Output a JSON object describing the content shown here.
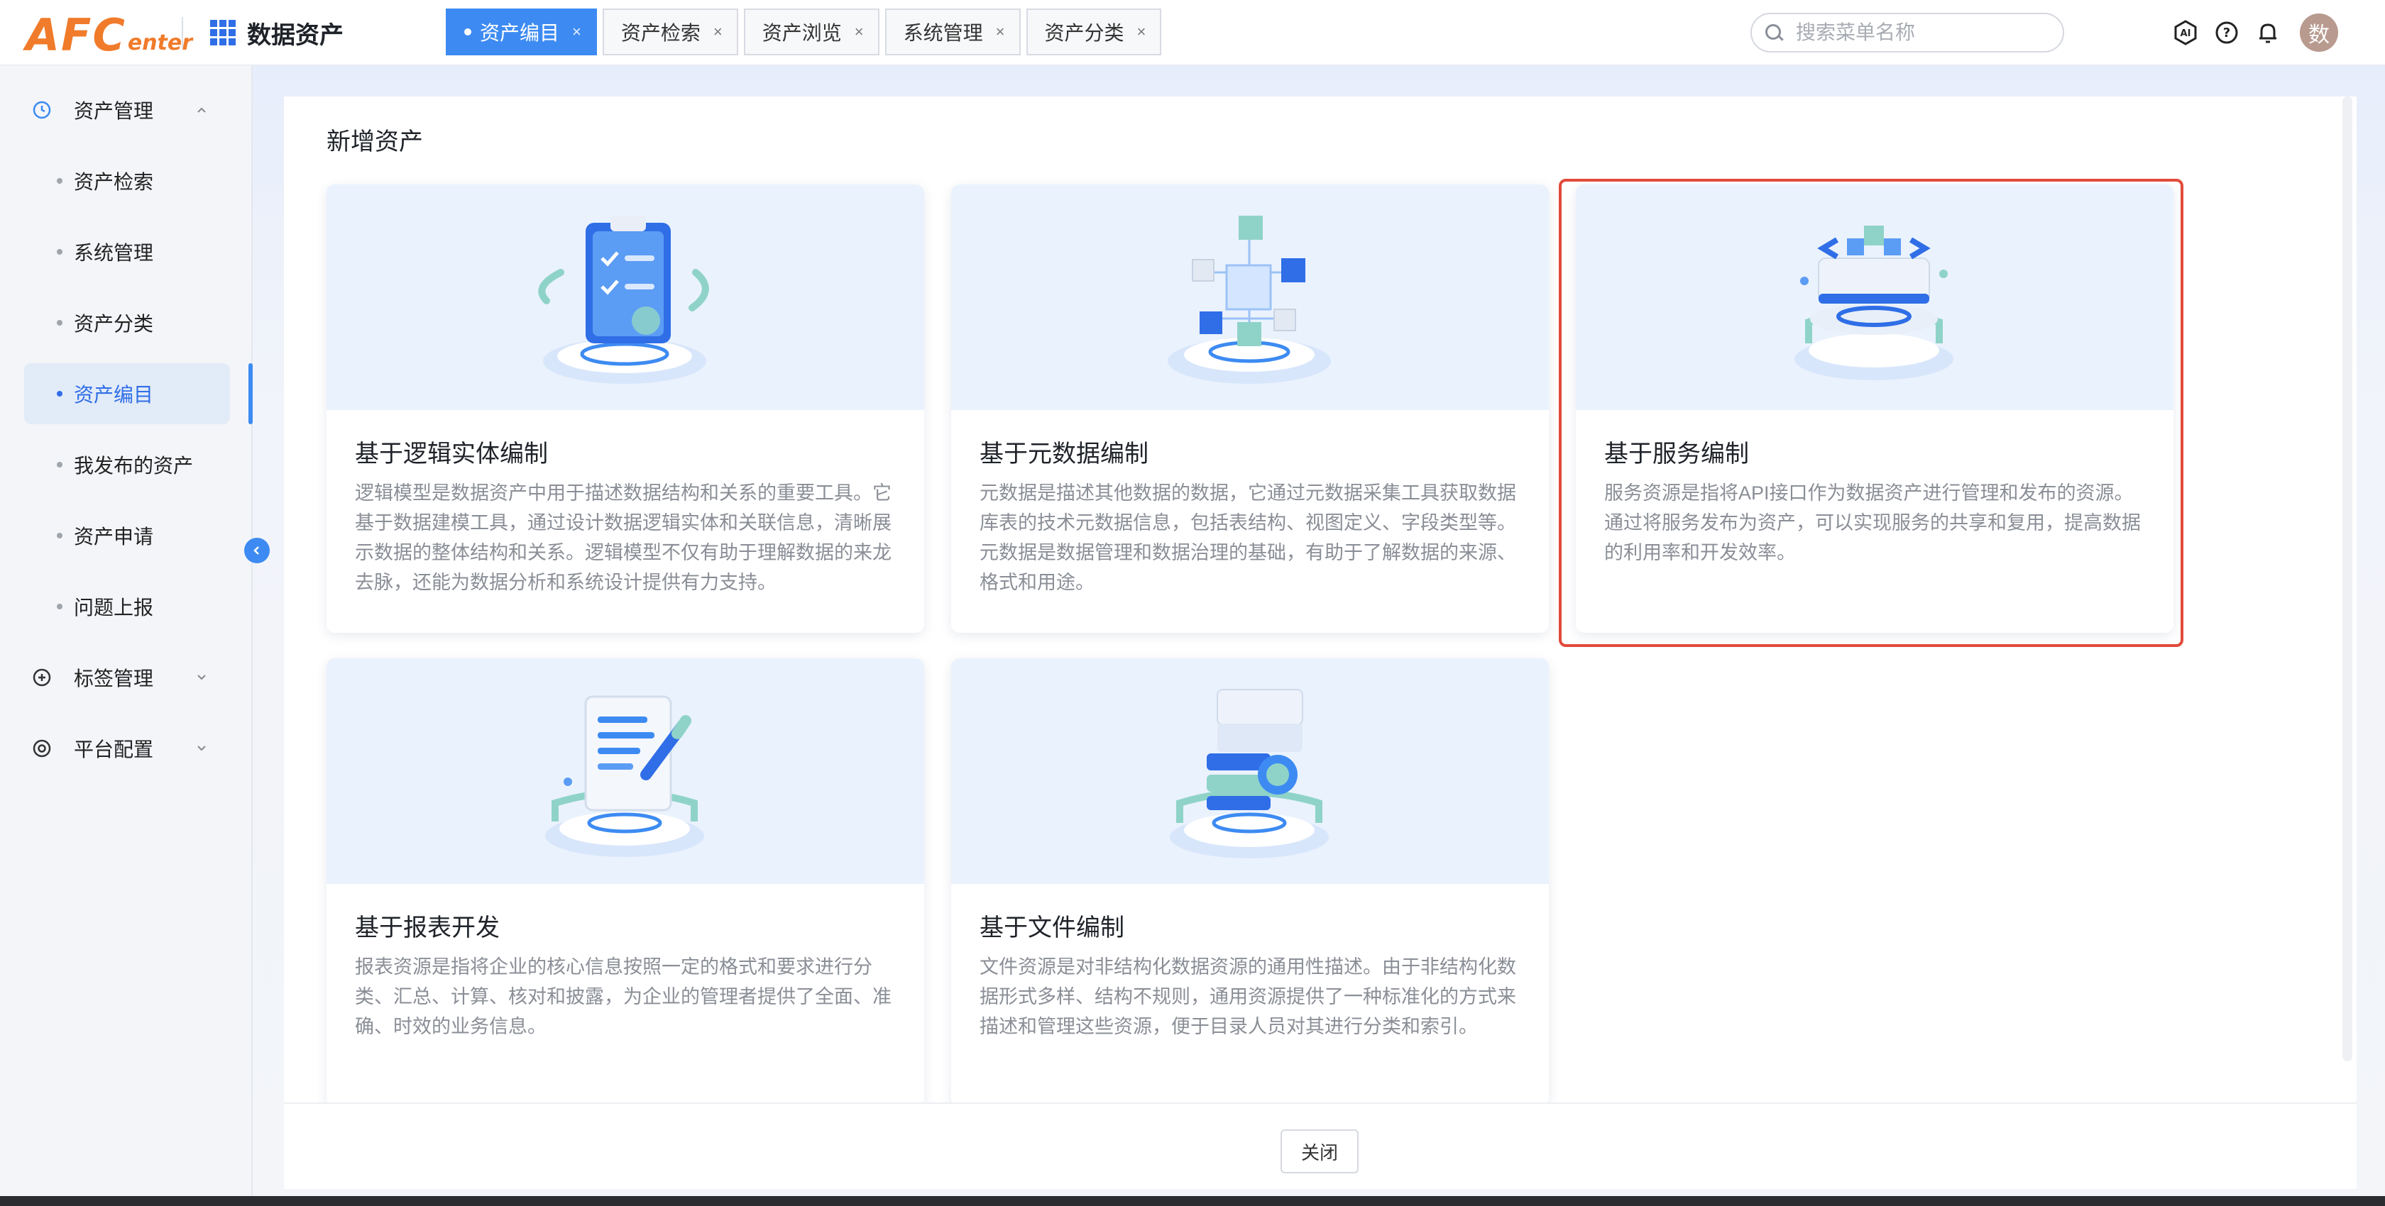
{
  "header": {
    "logo_big": "AFC",
    "logo_small": "enter",
    "app_title": "数据资产",
    "search_placeholder": "搜索菜单名称",
    "avatar_text": "数",
    "tabs": [
      {
        "label": "资产编目",
        "active": true
      },
      {
        "label": "资产检索",
        "active": false
      },
      {
        "label": "资产浏览",
        "active": false
      },
      {
        "label": "系统管理",
        "active": false
      },
      {
        "label": "资产分类",
        "active": false
      }
    ],
    "tab_close_glyph": "×"
  },
  "sidebar": {
    "groups": [
      {
        "label": "资产管理",
        "icon": "clock-icon",
        "expanded": true
      },
      {
        "label": "标签管理",
        "icon": "plus-circle-icon",
        "expanded": false
      },
      {
        "label": "平台配置",
        "icon": "target-icon",
        "expanded": false
      }
    ],
    "items": [
      {
        "label": "资产检索",
        "active": false
      },
      {
        "label": "系统管理",
        "active": false
      },
      {
        "label": "资产分类",
        "active": false
      },
      {
        "label": "资产编目",
        "active": true
      },
      {
        "label": "我发布的资产",
        "active": false
      },
      {
        "label": "资产申请",
        "active": false
      },
      {
        "label": "问题上报",
        "active": false
      }
    ]
  },
  "main": {
    "title": "新增资产",
    "cards": [
      {
        "title": "基于逻辑实体编制",
        "desc": "逻辑模型是数据资产中用于描述数据结构和关系的重要工具。它基于数据建模工具，通过设计数据逻辑实体和关联信息，清晰展示数据的整体结构和关系。逻辑模型不仅有助于理解数据的来龙去脉，还能为数据分析和系统设计提供有力支持。",
        "icon": "clipboard-check-icon"
      },
      {
        "title": "基于元数据编制",
        "desc": "元数据是描述其他数据的数据，它通过元数据采集工具获取数据库表的技术元数据信息，包括表结构、视图定义、字段类型等。元数据是数据管理和数据治理的基础，有助于了解数据的来源、格式和用途。",
        "icon": "cubes-network-icon"
      },
      {
        "title": "基于服务编制",
        "desc": "服务资源是指将API接口作为数据资产进行管理和发布的资源。通过将服务发布为资产，可以实现服务的共享和复用，提高数据的利用率和开发效率。",
        "icon": "code-server-icon",
        "selected": true
      },
      {
        "title": "基于报表开发",
        "desc": "报表资源是指将企业的核心信息按照一定的格式和要求进行分类、汇总、计算、核对和披露，为企业的管理者提供了全面、准确、时效的业务信息。",
        "icon": "report-pen-icon"
      },
      {
        "title": "基于文件编制",
        "desc": "文件资源是对非结构化数据资源的通用性描述。由于非结构化数据形式多样、结构不规则，通用资源提供了一种标准化的方式来描述和管理这些资源，便于目录人员对其进行分类和索引。",
        "icon": "file-server-icon"
      }
    ],
    "close_button": "关闭"
  },
  "colors": {
    "accent": "#3d8bf2",
    "logo": "#f07b2a",
    "selection_outline": "#e24a3b",
    "card_image_bg": "#eaf2fd"
  }
}
